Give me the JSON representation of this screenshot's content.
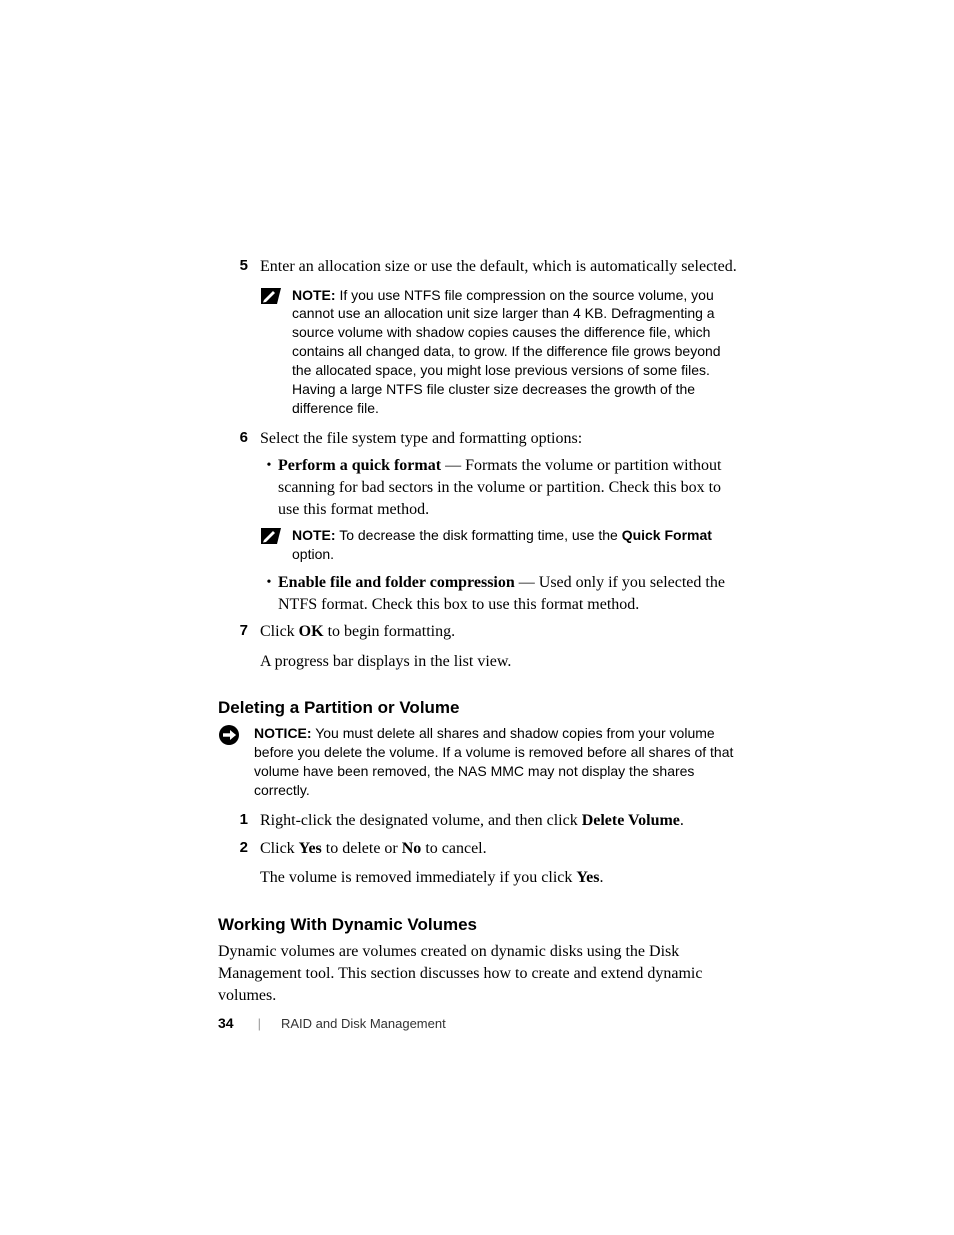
{
  "steps": {
    "s5": {
      "num": "5",
      "text": "Enter an allocation size or use the default, which is automatically selected."
    },
    "note1": {
      "label": "NOTE:",
      "text": " If you use NTFS file compression on the source volume, you cannot use an allocation unit size larger than 4 KB. Defragmenting a source volume with shadow copies causes the difference file, which contains all changed data, to grow. If the difference file grows beyond the allocated space, you might lose previous versions of some files. Having a large NTFS file cluster size decreases the growth of the difference file."
    },
    "s6": {
      "num": "6",
      "text": "Select the file system type and formatting options:",
      "b1_lead": "Perform a quick format",
      "b1_rest": " — Formats the volume or partition without scanning for bad sectors in the volume or partition. Check this box to use this format method.",
      "note2_label": "NOTE:",
      "note2_pre": " To decrease the disk formatting time, use the ",
      "note2_bold": "Quick Format",
      "note2_post": " option.",
      "b2_lead": "Enable file and folder compression",
      "b2_rest": " — Used only if you selected the NTFS format. Check this box to use this format method."
    },
    "s7": {
      "num": "7",
      "pre": "Click ",
      "ok": "OK",
      "post": " to begin formatting.",
      "after": "A progress bar displays in the list view."
    }
  },
  "section_delete": {
    "heading": "Deleting a Partition or Volume",
    "notice_label": "NOTICE:",
    "notice_text": " You must delete all shares and shadow copies from your volume before you delete the volume. If a volume is removed before all shares of that volume have been removed, the NAS MMC may not display the shares correctly.",
    "s1": {
      "num": "1",
      "pre": "Right-click the designated volume, and then click ",
      "bold": "Delete Volume",
      "post": "."
    },
    "s2": {
      "num": "2",
      "pre": "Click ",
      "yes": "Yes",
      "mid": " to delete or ",
      "no": "No",
      "post": " to cancel.",
      "after_pre": "The volume is removed immediately if you click ",
      "after_bold": "Yes",
      "after_post": "."
    }
  },
  "section_dynamic": {
    "heading": "Working With Dynamic Volumes",
    "intro": "Dynamic volumes are volumes created on dynamic disks using the Disk Management tool. This section discusses how to create and extend dynamic volumes."
  },
  "footer": {
    "page": "34",
    "separator": "|",
    "title": "RAID and Disk Management"
  }
}
